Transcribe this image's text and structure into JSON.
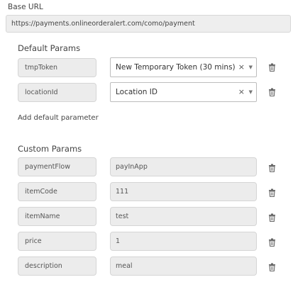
{
  "base": {
    "label": "Base URL",
    "url": "https://payments.onlineorderalert.com/como/payment"
  },
  "default_params": {
    "title": "Default Params",
    "items": [
      {
        "key": "tmpToken",
        "value": "New Temporary Token (30 mins)"
      },
      {
        "key": "locationId",
        "value": "Location ID"
      }
    ],
    "add_label": "Add default parameter"
  },
  "custom_params": {
    "title": "Custom Params",
    "items": [
      {
        "key": "paymentFlow",
        "value": "payInApp"
      },
      {
        "key": "itemCode",
        "value": "111"
      },
      {
        "key": "itemName",
        "value": "test"
      },
      {
        "key": "price",
        "value": "1"
      },
      {
        "key": "description",
        "value": "meal"
      }
    ]
  },
  "icons": {
    "clear": "close-icon",
    "caret": "chevron-down-icon",
    "delete": "trash-icon"
  },
  "glyphs": {
    "clear": "×",
    "caret": "▼"
  }
}
